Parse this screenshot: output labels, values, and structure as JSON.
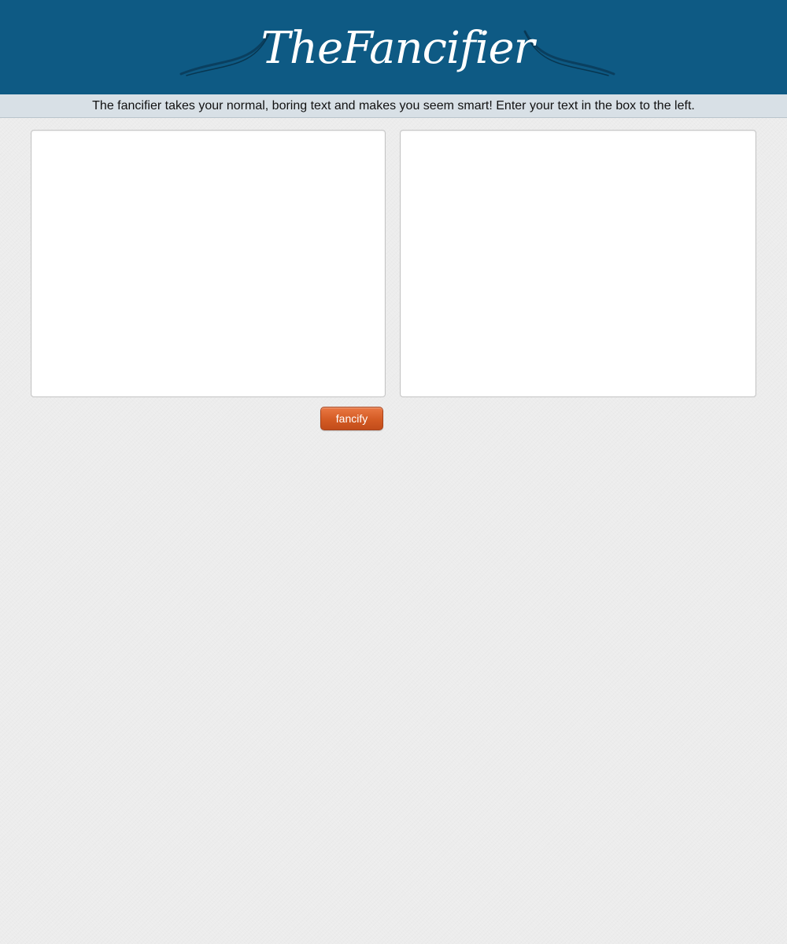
{
  "header": {
    "logo_text": "TheFancifier",
    "background_color": "#0e5a84"
  },
  "tagline": {
    "text": "The fancifier takes your normal, boring text and makes you seem smart! Enter your text in the box to the left."
  },
  "editor": {
    "input_value": "",
    "output_value": ""
  },
  "actions": {
    "fancify_label": "fancify",
    "button_color": "#d45b24"
  }
}
